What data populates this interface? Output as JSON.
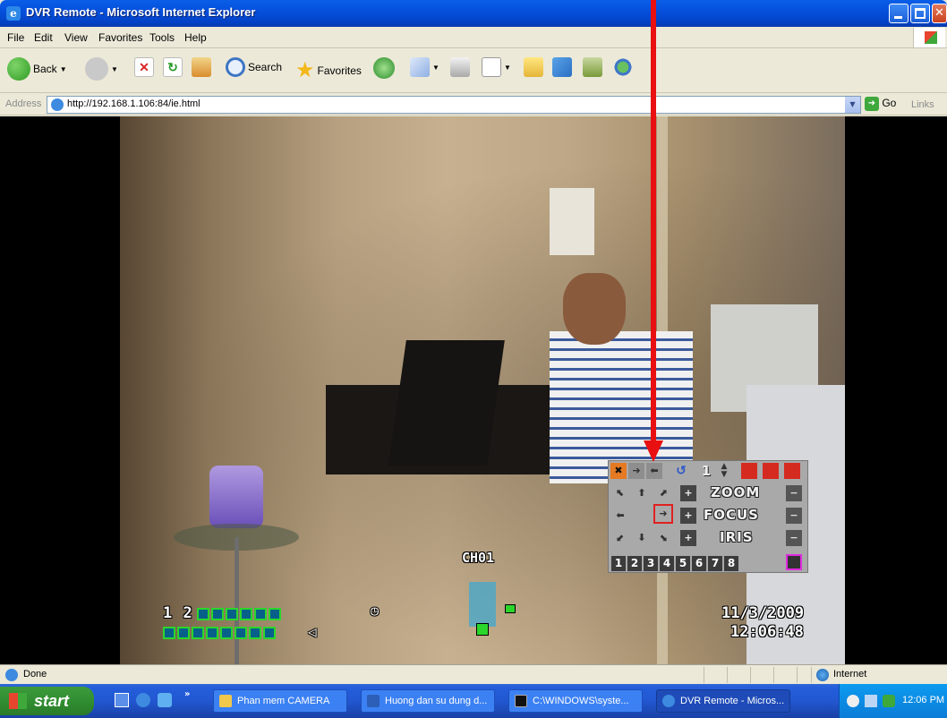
{
  "window": {
    "title": "DVR Remote - Microsoft Internet Explorer"
  },
  "menu": [
    "File",
    "Edit",
    "View",
    "Favorites",
    "Tools",
    "Help"
  ],
  "toolbar": {
    "back": "Back",
    "search": "Search",
    "favorites": "Favorites"
  },
  "address": {
    "label": "Address",
    "url": "http://192.168.1.106:84/ie.html",
    "go": "Go",
    "links": "Links"
  },
  "video": {
    "channel": "CH01",
    "channel_digits": "1 2",
    "date": "11/3/2009",
    "time": "12:06:48"
  },
  "ptz": {
    "zoom": "ZOOM",
    "focus": "FOCUS",
    "iris": "IRIS",
    "preset": "1",
    "channels": [
      "1",
      "2",
      "3",
      "4",
      "5",
      "6",
      "7",
      "8"
    ]
  },
  "status": {
    "text": "Done",
    "zone": "Internet"
  },
  "taskbar": {
    "start": "start",
    "tasks": [
      "Phan mem CAMERA",
      "Huong dan su dung d...",
      "C:\\WINDOWS\\syste...",
      "DVR Remote - Micros..."
    ],
    "clock": "12:06 PM"
  },
  "colors": {
    "arrow": "#e81010",
    "titlebar": "#0550dc",
    "grid_box": "#2bd62b",
    "ptz_highlight": "#e02020"
  }
}
